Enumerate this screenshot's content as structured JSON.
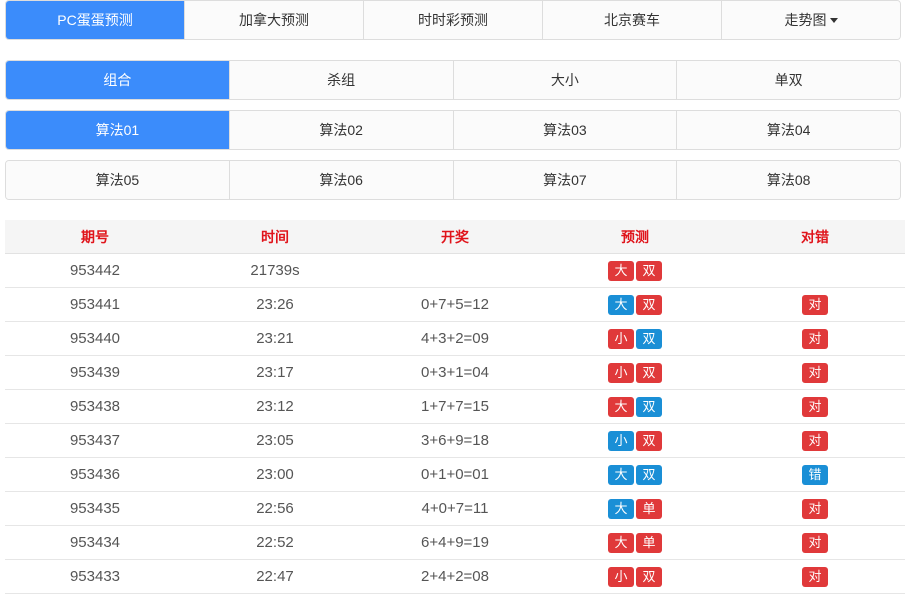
{
  "colors": {
    "accent": "#3b8cfb",
    "red_badge": "#e0393a",
    "blue_badge": "#1a8fd6",
    "header_text": "#e0141b"
  },
  "nav": {
    "tabs": [
      {
        "label": "PC蛋蛋预测",
        "active": true
      },
      {
        "label": "加拿大预测",
        "active": false
      },
      {
        "label": "时时彩预测",
        "active": false
      },
      {
        "label": "北京赛车",
        "active": false
      },
      {
        "label": "走势图",
        "active": false,
        "dropdown": true,
        "icon": "caret-down-icon"
      }
    ]
  },
  "type_tabs": [
    {
      "label": "组合",
      "active": true
    },
    {
      "label": "杀组",
      "active": false
    },
    {
      "label": "大小",
      "active": false
    },
    {
      "label": "单双",
      "active": false
    }
  ],
  "algo_tabs": [
    {
      "label": "算法01",
      "active": true
    },
    {
      "label": "算法02",
      "active": false
    },
    {
      "label": "算法03",
      "active": false
    },
    {
      "label": "算法04",
      "active": false
    },
    {
      "label": "算法05",
      "active": false
    },
    {
      "label": "算法06",
      "active": false
    },
    {
      "label": "算法07",
      "active": false
    },
    {
      "label": "算法08",
      "active": false
    }
  ],
  "table": {
    "headers": [
      "期号",
      "时间",
      "开奖",
      "预测",
      "对错"
    ],
    "rows": [
      {
        "issue": "953442",
        "time": "21739s",
        "draw": "",
        "pred": [
          {
            "t": "大",
            "c": "red"
          },
          {
            "t": "双",
            "c": "red"
          }
        ],
        "result": null
      },
      {
        "issue": "953441",
        "time": "23:26",
        "draw": "0+7+5=12",
        "pred": [
          {
            "t": "大",
            "c": "blue"
          },
          {
            "t": "双",
            "c": "red"
          }
        ],
        "result": {
          "t": "对",
          "c": "red"
        }
      },
      {
        "issue": "953440",
        "time": "23:21",
        "draw": "4+3+2=09",
        "pred": [
          {
            "t": "小",
            "c": "red"
          },
          {
            "t": "双",
            "c": "blue"
          }
        ],
        "result": {
          "t": "对",
          "c": "red"
        }
      },
      {
        "issue": "953439",
        "time": "23:17",
        "draw": "0+3+1=04",
        "pred": [
          {
            "t": "小",
            "c": "red"
          },
          {
            "t": "双",
            "c": "red"
          }
        ],
        "result": {
          "t": "对",
          "c": "red"
        }
      },
      {
        "issue": "953438",
        "time": "23:12",
        "draw": "1+7+7=15",
        "pred": [
          {
            "t": "大",
            "c": "red"
          },
          {
            "t": "双",
            "c": "blue"
          }
        ],
        "result": {
          "t": "对",
          "c": "red"
        }
      },
      {
        "issue": "953437",
        "time": "23:05",
        "draw": "3+6+9=18",
        "pred": [
          {
            "t": "小",
            "c": "blue"
          },
          {
            "t": "双",
            "c": "red"
          }
        ],
        "result": {
          "t": "对",
          "c": "red"
        }
      },
      {
        "issue": "953436",
        "time": "23:00",
        "draw": "0+1+0=01",
        "pred": [
          {
            "t": "大",
            "c": "blue"
          },
          {
            "t": "双",
            "c": "blue"
          }
        ],
        "result": {
          "t": "错",
          "c": "blue"
        }
      },
      {
        "issue": "953435",
        "time": "22:56",
        "draw": "4+0+7=11",
        "pred": [
          {
            "t": "大",
            "c": "blue"
          },
          {
            "t": "单",
            "c": "red"
          }
        ],
        "result": {
          "t": "对",
          "c": "red"
        }
      },
      {
        "issue": "953434",
        "time": "22:52",
        "draw": "6+4+9=19",
        "pred": [
          {
            "t": "大",
            "c": "red"
          },
          {
            "t": "单",
            "c": "red"
          }
        ],
        "result": {
          "t": "对",
          "c": "red"
        }
      },
      {
        "issue": "953433",
        "time": "22:47",
        "draw": "2+4+2=08",
        "pred": [
          {
            "t": "小",
            "c": "red"
          },
          {
            "t": "双",
            "c": "red"
          }
        ],
        "result": {
          "t": "对",
          "c": "red"
        }
      }
    ]
  }
}
